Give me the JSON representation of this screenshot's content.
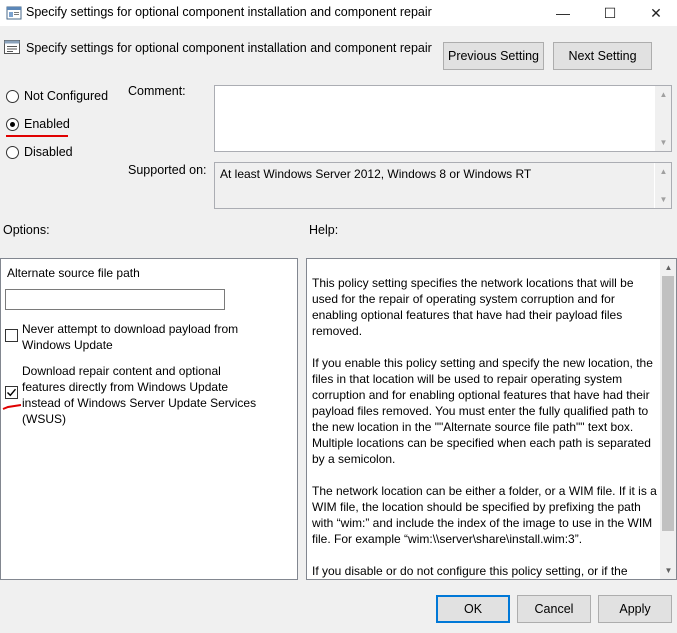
{
  "window": {
    "title": "Specify settings for optional component installation and component repair",
    "minimize": "—",
    "maximize": "☐",
    "close": "✕"
  },
  "header": {
    "setting_title": "Specify settings for optional component installation and component repair",
    "previous_label": "Previous Setting",
    "next_label": "Next Setting"
  },
  "state": {
    "not_configured": "Not Configured",
    "enabled": "Enabled",
    "disabled": "Disabled",
    "selected": "Enabled"
  },
  "comment": {
    "label": "Comment:",
    "value": ""
  },
  "supported": {
    "label": "Supported on:",
    "value": "At least Windows Server 2012, Windows 8 or Windows RT"
  },
  "options": {
    "label": "Options:",
    "alt_source_label": "Alternate source file path",
    "alt_source_value": "",
    "never_download": {
      "label": "Never attempt to download payload from Windows Update",
      "checked": false
    },
    "download_wu": {
      "label": "Download repair content and optional features directly from Windows Update instead of Windows Server Update Services (WSUS)",
      "checked": true
    }
  },
  "help": {
    "label": "Help:",
    "paragraphs": [
      "This policy setting specifies the network locations that will be used for the repair of operating system corruption and for enabling optional features that have had their payload files removed.",
      "If you enable this policy setting and specify the new location, the files in that location will be used to repair operating system corruption and for enabling optional features that have had their payload files removed. You must enter the fully qualified path to the new location in the \"\"Alternate source file path\"\" text box. Multiple locations can be specified when each path is separated by a semicolon.",
      "The network location can be either a folder, or a WIM file. If it is a WIM file, the location should be specified by prefixing the path with “wim:” and include the index of the image to use in the WIM file. For example “wim:\\\\server\\share\\install.wim:3”.",
      "If you disable or do not configure this policy setting, or if the required files cannot be found at the locations specified in this policy setting, the files will be downloaded from Windows Update, if that is allowed by the policy settings for the computer."
    ]
  },
  "footer": {
    "ok": "OK",
    "cancel": "Cancel",
    "apply": "Apply"
  },
  "colors": {
    "accent": "#0078d7",
    "annotation_red": "#e00000",
    "dialog_bg": "#f0f0f0"
  }
}
